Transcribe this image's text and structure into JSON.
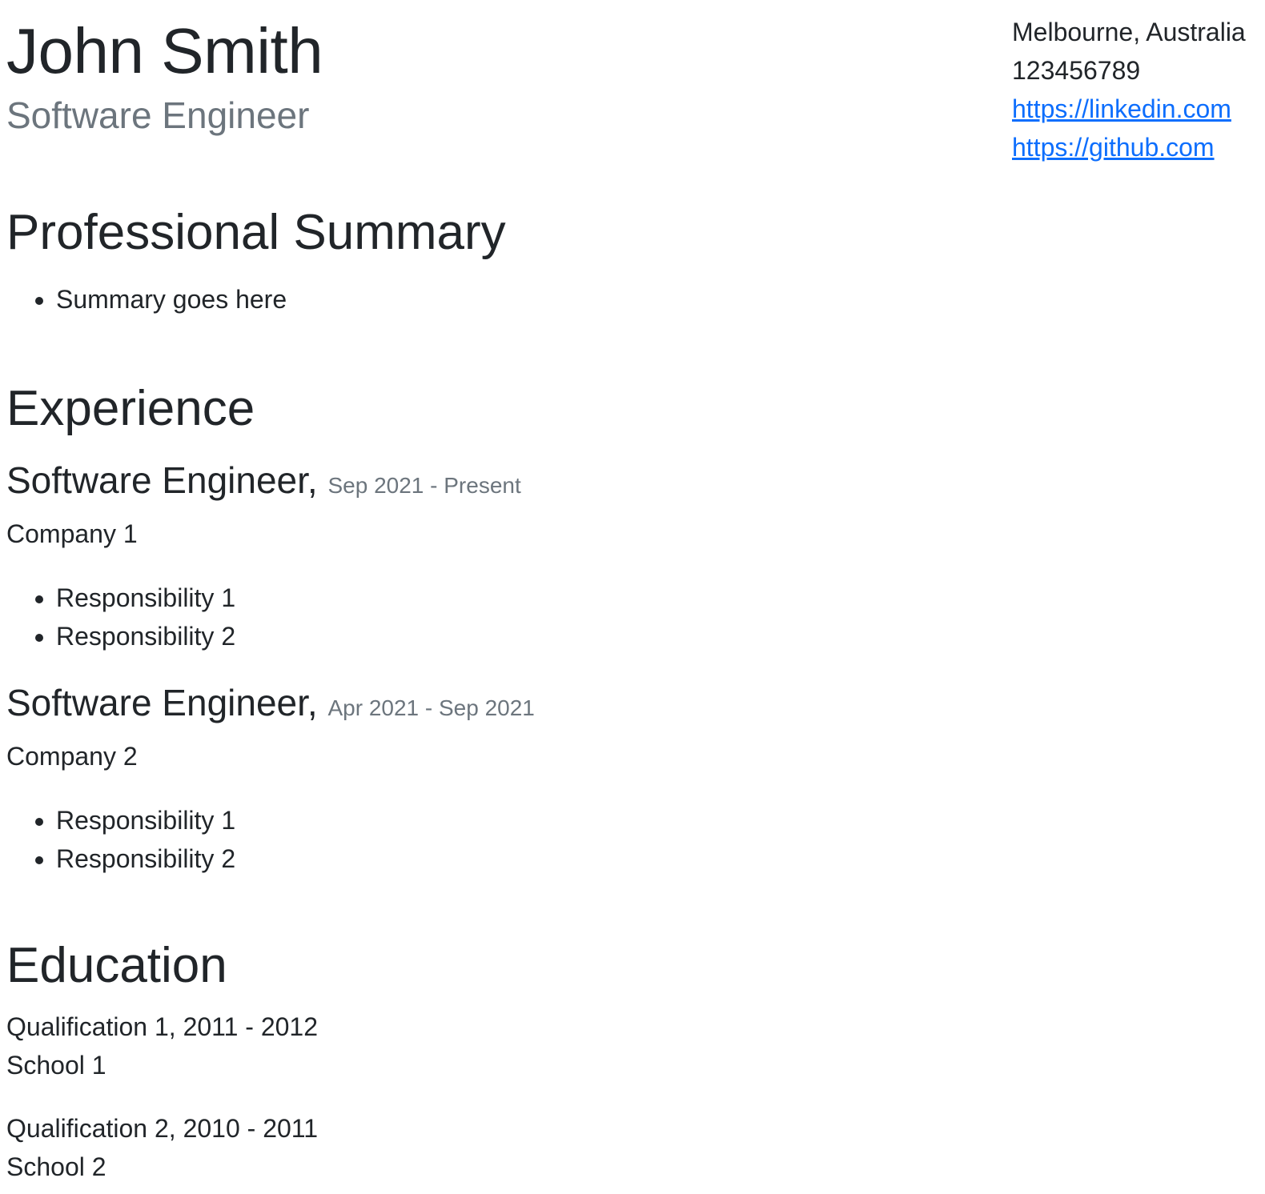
{
  "header": {
    "name": "John Smith",
    "title": "Software Engineer"
  },
  "contact": {
    "location": "Melbourne, Australia",
    "phone": "123456789",
    "linkedin": "https://linkedin.com",
    "github": "https://github.com"
  },
  "summary": {
    "heading": "Professional Summary",
    "items": [
      "Summary goes here"
    ]
  },
  "experience": {
    "heading": "Experience",
    "jobs": [
      {
        "title": "Software Engineer",
        "separator": ",",
        "dates": "Sep 2021 - Present",
        "company": "Company 1",
        "responsibilities": [
          "Responsibility 1",
          "Responsibility 2"
        ]
      },
      {
        "title": "Software Engineer",
        "separator": ",",
        "dates": "Apr 2021 - Sep 2021",
        "company": "Company 2",
        "responsibilities": [
          "Responsibility 1",
          "Responsibility 2"
        ]
      }
    ]
  },
  "education": {
    "heading": "Education",
    "entries": [
      {
        "qualification": "Qualification 1, 2011 - 2012",
        "school": "School 1"
      },
      {
        "qualification": "Qualification 2, 2010 - 2011",
        "school": "School 2"
      }
    ]
  },
  "colors": {
    "text": "#212529",
    "muted": "#6c757d",
    "link": "#0d6efd"
  }
}
